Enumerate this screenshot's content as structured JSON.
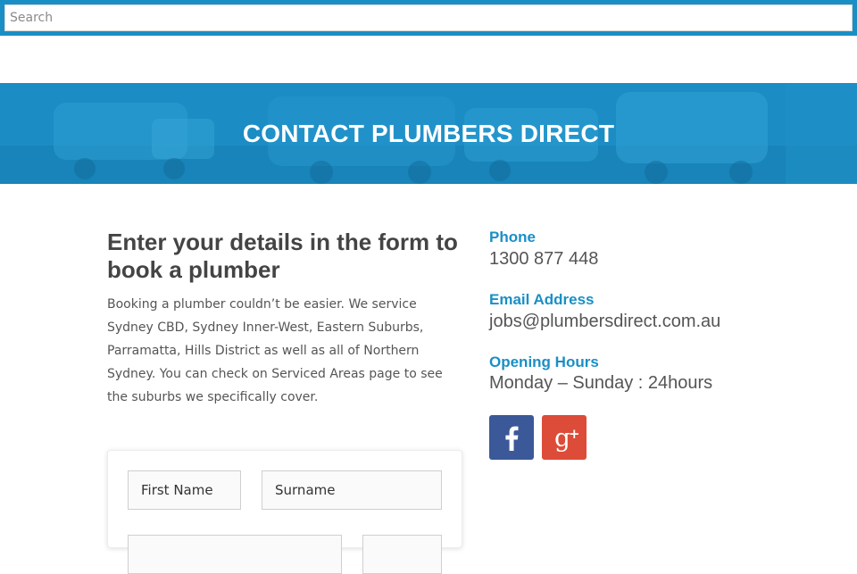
{
  "search": {
    "placeholder": "Search"
  },
  "hero": {
    "title": "CONTACT PLUMBERS DIRECT"
  },
  "form_section": {
    "heading": "Enter your details in the form to book a plumber",
    "intro": "Booking a plumber couldn’t be easier. We service Sydney CBD, Sydney Inner-West, Eastern Suburbs, Parramatta, Hills District as well as all of Northern Sydney. You can check on Serviced Areas page to see the suburbs we specifically cover.",
    "fields": {
      "first_name": "First Name",
      "surname": "Surname"
    }
  },
  "contact": {
    "phone_label": "Phone",
    "phone": "1300 877 448",
    "email_label": "Email Address",
    "email": "jobs@plumbersdirect.com.au",
    "hours_label": "Opening Hours",
    "hours": "Monday – Sunday : 24hours"
  },
  "social": [
    {
      "network": "facebook",
      "icon": "facebook-icon",
      "color": "#3b5998"
    },
    {
      "network": "google-plus",
      "icon": "google-plus-icon",
      "color": "#dd4b39"
    }
  ],
  "colors": {
    "brand": "#1a8fc5",
    "heading": "#444444",
    "body": "#555555"
  }
}
